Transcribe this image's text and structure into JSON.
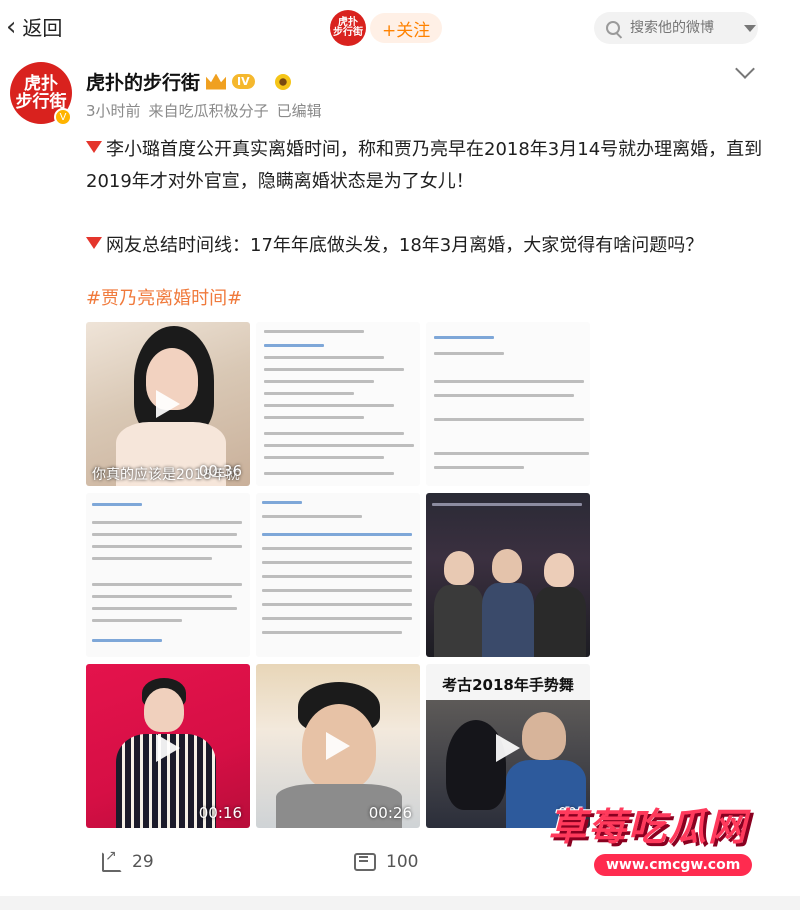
{
  "topbar": {
    "back_label": "返回",
    "follow_avatar_text": [
      "虎扑",
      "步行街"
    ],
    "follow_label": "+关注",
    "search_placeholder": "搜索他的微博"
  },
  "post": {
    "author": "虎扑的步行街",
    "avatar_text": [
      "虎扑",
      "步行街"
    ],
    "level_badge": "IV",
    "time": "3小时前",
    "source_prefix": "来自",
    "source": "吃瓜积极分子",
    "edited": "已编辑",
    "paragraph1": "李小璐首度公开真实离婚时间，称和贾乃亮早在2018年3月14号就办理离婚，直到2019年才对外官宣，隐瞒离婚状态是为了女儿！",
    "paragraph2": "网友总结时间线：17年年底做头发，18年3月离婚，大家觉得有啥问题吗？",
    "hashtag": "#贾乃亮离婚时间#",
    "media": [
      {
        "type": "video",
        "duration": "00:36",
        "caption": "你真的应该是2018年就"
      },
      {
        "type": "image"
      },
      {
        "type": "image"
      },
      {
        "type": "image"
      },
      {
        "type": "image"
      },
      {
        "type": "image"
      },
      {
        "type": "video",
        "duration": "00:16"
      },
      {
        "type": "video",
        "duration": "00:26"
      },
      {
        "type": "video",
        "duration": "00:",
        "title": "考古2018年手势舞"
      }
    ],
    "reposts": "29",
    "comments": "100"
  },
  "watermark": {
    "title": "草莓吃瓜网",
    "url": "www.cmcgw.com"
  }
}
